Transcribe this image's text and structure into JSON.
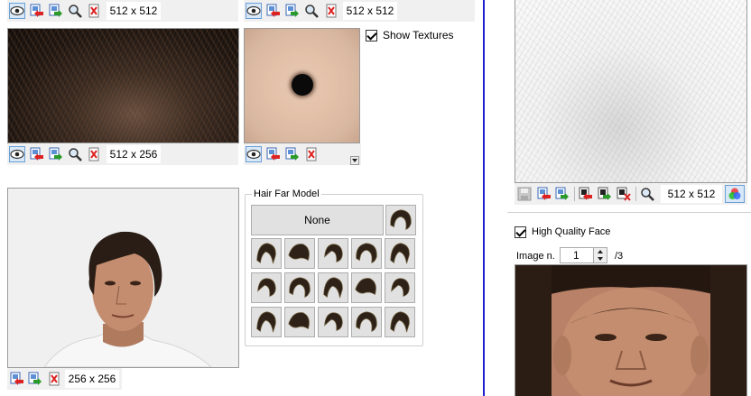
{
  "top_left_panel": {
    "size_label": "512 x 512",
    "texture_size_label": "512 x 256",
    "show_textures_label": "Show Textures",
    "show_textures_checked": true
  },
  "top_mid_panel": {
    "size_label": "512 x 512"
  },
  "preview_panel": {
    "size_label": "256 x 256"
  },
  "hair_far_model": {
    "group_label": "Hair Far Model",
    "none_label": "None",
    "selected_index": 16
  },
  "right_panel": {
    "size_label": "512 x 512",
    "hq_face_label": "High Quality Face",
    "hq_face_checked": true,
    "image_n_label": "Image n.",
    "image_n_value": "1",
    "image_n_total": "/3"
  },
  "colors": {
    "divider_blue": "#1f1fd1",
    "selection_blue": "#9cc9f0",
    "toolbar_gray": "#f0f0f0"
  },
  "icons": [
    "eye-icon",
    "import-icon",
    "export-icon",
    "magnifier-icon",
    "delete-icon",
    "save-icon",
    "import-alpha-icon",
    "export-alpha-icon",
    "delete-alpha-icon",
    "color-channels-icon",
    "dropdown-arrow-icon"
  ]
}
